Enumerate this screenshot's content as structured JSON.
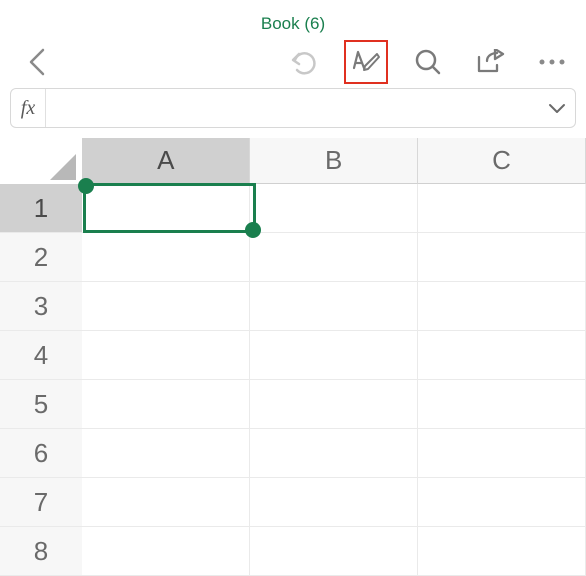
{
  "title": "Book (6)",
  "formula_bar": {
    "fx": "fx",
    "value": ""
  },
  "columns": [
    "A",
    "B",
    "C"
  ],
  "rows": [
    "1",
    "2",
    "3",
    "4",
    "5",
    "6",
    "7",
    "8"
  ],
  "selection": {
    "col": "A",
    "row": "1"
  },
  "icons": {
    "back": "back-icon",
    "undo": "undo-icon",
    "edit": "edit-icon",
    "search": "search-icon",
    "share": "share-icon",
    "more": "more-icon",
    "expand": "expand-icon",
    "selectall": "select-all-icon"
  },
  "colors": {
    "accent": "#1a7f4e",
    "highlight": "#e03020"
  }
}
